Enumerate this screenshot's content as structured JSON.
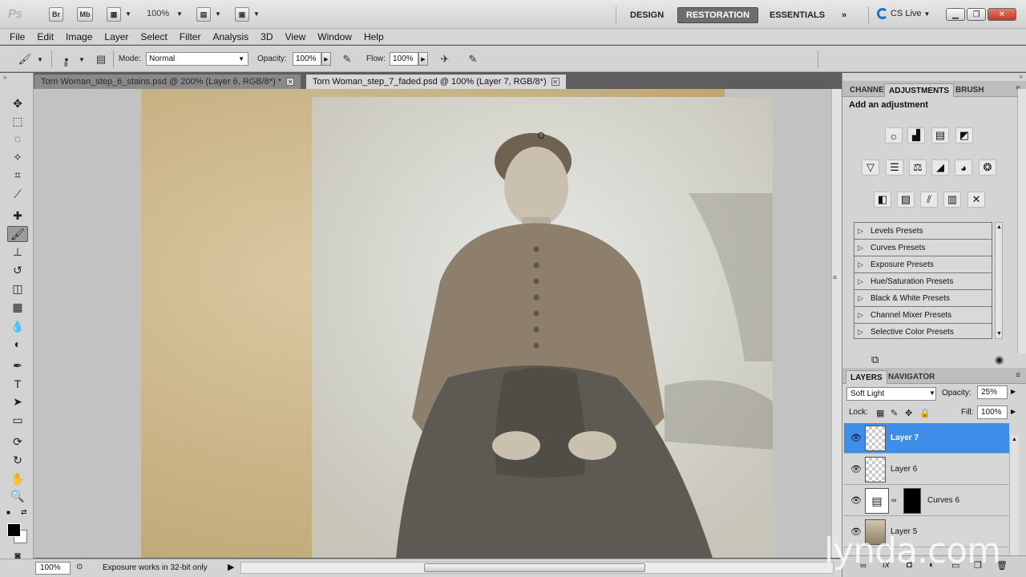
{
  "appbar": {
    "logo": "Ps",
    "bridge_btn": "Br",
    "minibridge_btn": "Mb",
    "zoom": "100%",
    "workspaces": [
      "DESIGN",
      "RESTORATION",
      "ESSENTIALS"
    ],
    "active_workspace": "RESTORATION",
    "more": "»",
    "cs_live": "CS Live"
  },
  "menu": [
    "File",
    "Edit",
    "Image",
    "Layer",
    "Select",
    "Filter",
    "Analysis",
    "3D",
    "View",
    "Window",
    "Help"
  ],
  "options": {
    "brush_size": "8",
    "mode_label": "Mode:",
    "mode_value": "Normal",
    "opacity_label": "Opacity:",
    "opacity_value": "100%",
    "flow_label": "Flow:",
    "flow_value": "100%"
  },
  "tabs": [
    {
      "title": "Torn Woman_step_6_stains.psd @ 200% (Layer 6, RGB/8*) *",
      "active": false
    },
    {
      "title": "Torn Woman_step_7_faded.psd @ 100% (Layer 7, RGB/8*)",
      "active": true
    }
  ],
  "status": {
    "zoom": "100%",
    "message": "Exposure works in 32-bit only"
  },
  "adjustments_panel": {
    "tabs": [
      "CHANNE",
      "ADJUSTMENTS",
      "BRUSH"
    ],
    "active_tab": "ADJUSTMENTS",
    "title": "Add an adjustment",
    "presets": [
      "Levels Presets",
      "Curves Presets",
      "Exposure Presets",
      "Hue/Saturation Presets",
      "Black & White Presets",
      "Channel Mixer Presets",
      "Selective Color Presets"
    ]
  },
  "layers_panel": {
    "tabs": [
      "LAYERS",
      "NAVIGATOR"
    ],
    "active_tab": "LAYERS",
    "blend_mode": "Soft Light",
    "opacity_label": "Opacity:",
    "opacity_value": "25%",
    "lock_label": "Lock:",
    "fill_label": "Fill:",
    "fill_value": "100%",
    "layers": [
      {
        "name": "Layer 7",
        "selected": true
      },
      {
        "name": "Layer 6",
        "selected": false
      },
      {
        "name": "Curves 6",
        "selected": false
      },
      {
        "name": "Layer 5",
        "selected": false
      }
    ]
  },
  "watermark": "lynda.com",
  "colors": {
    "selection_blue": "#3d8ee8",
    "panel_gray": "#d4d4d4",
    "canvas_gray": "#c2c2c2"
  }
}
